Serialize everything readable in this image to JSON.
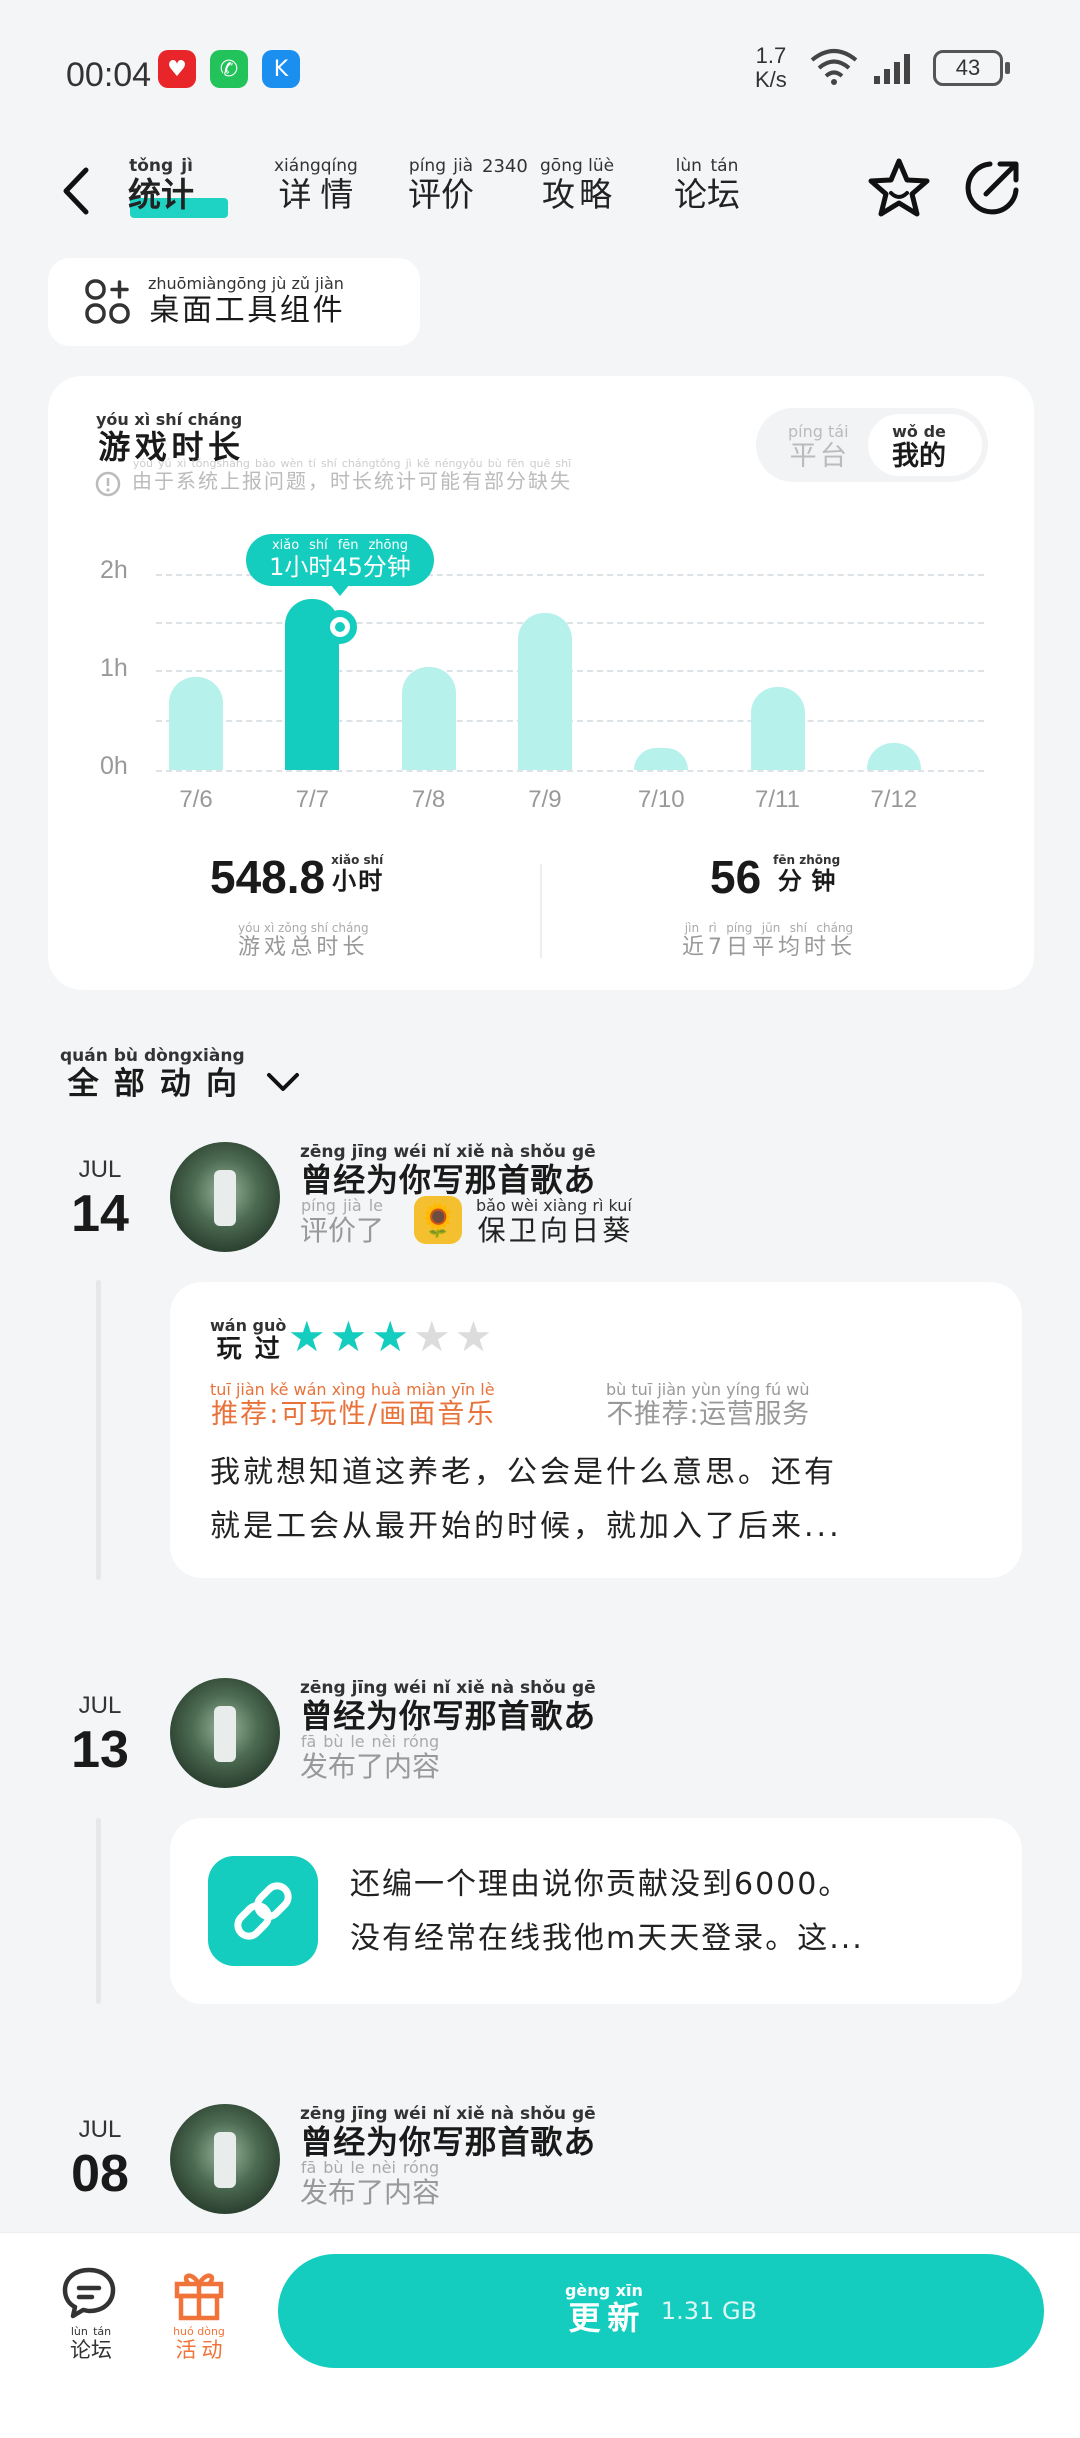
{
  "status": {
    "time": "00:04",
    "speed_value": "1.7",
    "speed_unit": "K/s",
    "battery": "43"
  },
  "nav": {
    "tabs": [
      {
        "label": "统计",
        "pinyin": "tǒng jì"
      },
      {
        "label": "详情",
        "pinyin": "xiángqíng"
      },
      {
        "label": "评价",
        "pinyin": "píng jià",
        "count": "2340"
      },
      {
        "label": "攻略",
        "pinyin": "gōng lüè"
      },
      {
        "label": "论坛",
        "pinyin": "lùn tán"
      }
    ]
  },
  "widget": {
    "label": "桌面工具组件",
    "pinyin": "zhuōmiàngōng jù  zǔ  jiàn"
  },
  "playtime": {
    "title": "游戏时长",
    "title_pinyin": "yóu  xì  shí cháng",
    "note": "由于系统上报问题，时长统计可能有部分缺失",
    "note_pinyin": "yóu yú xì tǒngshàng bào wèn tí shí chángtǒng jì kě néngyǒu bù fēn quē shī",
    "seg_platform": "平台",
    "seg_platform_pinyin": "píng tái",
    "seg_mine": "我的",
    "seg_mine_pinyin": "wǒ de",
    "tooltip": "1小时45分钟",
    "tooltip_pinyin": "xiǎo shí    fēn zhōng",
    "total_value": "548.8",
    "total_unit": "小时",
    "total_unit_pinyin": "xiǎo shí",
    "total_label": "游戏总时长",
    "total_label_pinyin": "yóu  xì  zǒng shí cháng",
    "avg_value": "56",
    "avg_unit": "分钟",
    "avg_unit_pinyin": "fēn zhōng",
    "avg_label": "近7日平均时长",
    "avg_label_pinyin": "jìn    rì píng jūn shí cháng"
  },
  "chart_data": {
    "type": "bar",
    "categories": [
      "7/6",
      "7/7",
      "7/8",
      "7/9",
      "7/10",
      "7/11",
      "7/12"
    ],
    "values": [
      0.95,
      1.75,
      1.05,
      1.6,
      0.22,
      0.85,
      0.28
    ],
    "y_ticks": [
      "0h",
      "1h",
      "2h"
    ],
    "ylim": [
      0,
      2
    ],
    "selected_index": 1,
    "grid": true
  },
  "feed": {
    "filter": "全部动向",
    "filter_pinyin": "quán  bù  dòngxiàng",
    "user": "曾经为你写那首歌あ",
    "user_pinyin": "zēng jīng wéi  nǐ  xiě  nà  shǒu  gē",
    "items": [
      {
        "month": "JUL",
        "day": "14",
        "action": "评价了",
        "action_pinyin": "píng  jià  le",
        "game": "保卫向日葵",
        "game_pinyin": "bǎo wèi xiàng rì  kuí",
        "played": "玩过",
        "played_pinyin": "wán guò",
        "recommend": "推荐:可玩性/画面音乐",
        "recommend_pinyin": "tuī  jiàn    kě  wán xìng    huà miàn yīn  lè",
        "not_recommend": "不推荐:运营服务",
        "not_recommend_pinyin": "bù  tuī  jiàn    yùn yíng  fú  wù",
        "line1": "我就想知道这养老，公会是什么意思。还有",
        "line2": "就是工会从最开始的时候，就加入了后来..."
      },
      {
        "month": "JUL",
        "day": "13",
        "action": "发布了内容",
        "action_pinyin": "fā   bù   le   nèi róng",
        "line1": "还编一个理由说你贡献没到6000。",
        "line2": "没有经常在线我他m天天登录。这..."
      },
      {
        "month": "JUL",
        "day": "08",
        "action": "发布了内容",
        "action_pinyin": "fā   bù   le   nèi róng"
      }
    ]
  },
  "bottom": {
    "forum": "论坛",
    "forum_pinyin": "lùn  tán",
    "activity": "活动",
    "activity_pinyin": "huó dòng",
    "update": "更新",
    "update_pinyin": "gèng xīn",
    "update_size": "1.31 GB"
  },
  "colors": {
    "accent": "#14cdbf",
    "bar_light": "#b6f1ec",
    "recommend": "#e8723a",
    "activity": "#f0743a"
  }
}
